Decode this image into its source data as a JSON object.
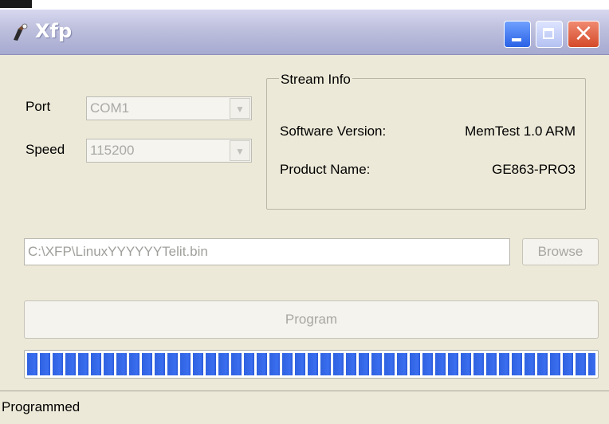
{
  "window": {
    "title": "Xfp"
  },
  "port": {
    "label": "Port",
    "value": "COM1"
  },
  "speed": {
    "label": "Speed",
    "value": "115200"
  },
  "stream_info": {
    "title": "Stream Info",
    "software_version_label": "Software Version:",
    "software_version_value": "MemTest 1.0 ARM",
    "product_name_label": "Product Name:",
    "product_name_value": "GE863-PRO3"
  },
  "file": {
    "path": "C:\\XFP\\LinuxYYYYYYTelit.bin",
    "browse_label": "Browse"
  },
  "program_label": "Program",
  "progress": {
    "fraction": 1.0
  },
  "status": {
    "text": "Programmed"
  },
  "icons": {
    "app": "xfp-app-icon",
    "minimize": "minimize-icon",
    "maximize": "maximize-icon",
    "close": "close-icon",
    "dropdown": "chevron-down-icon"
  },
  "colors": {
    "progress": "#2f62e0",
    "titlebar": "#bfc1de",
    "close": "#d44a2a"
  }
}
